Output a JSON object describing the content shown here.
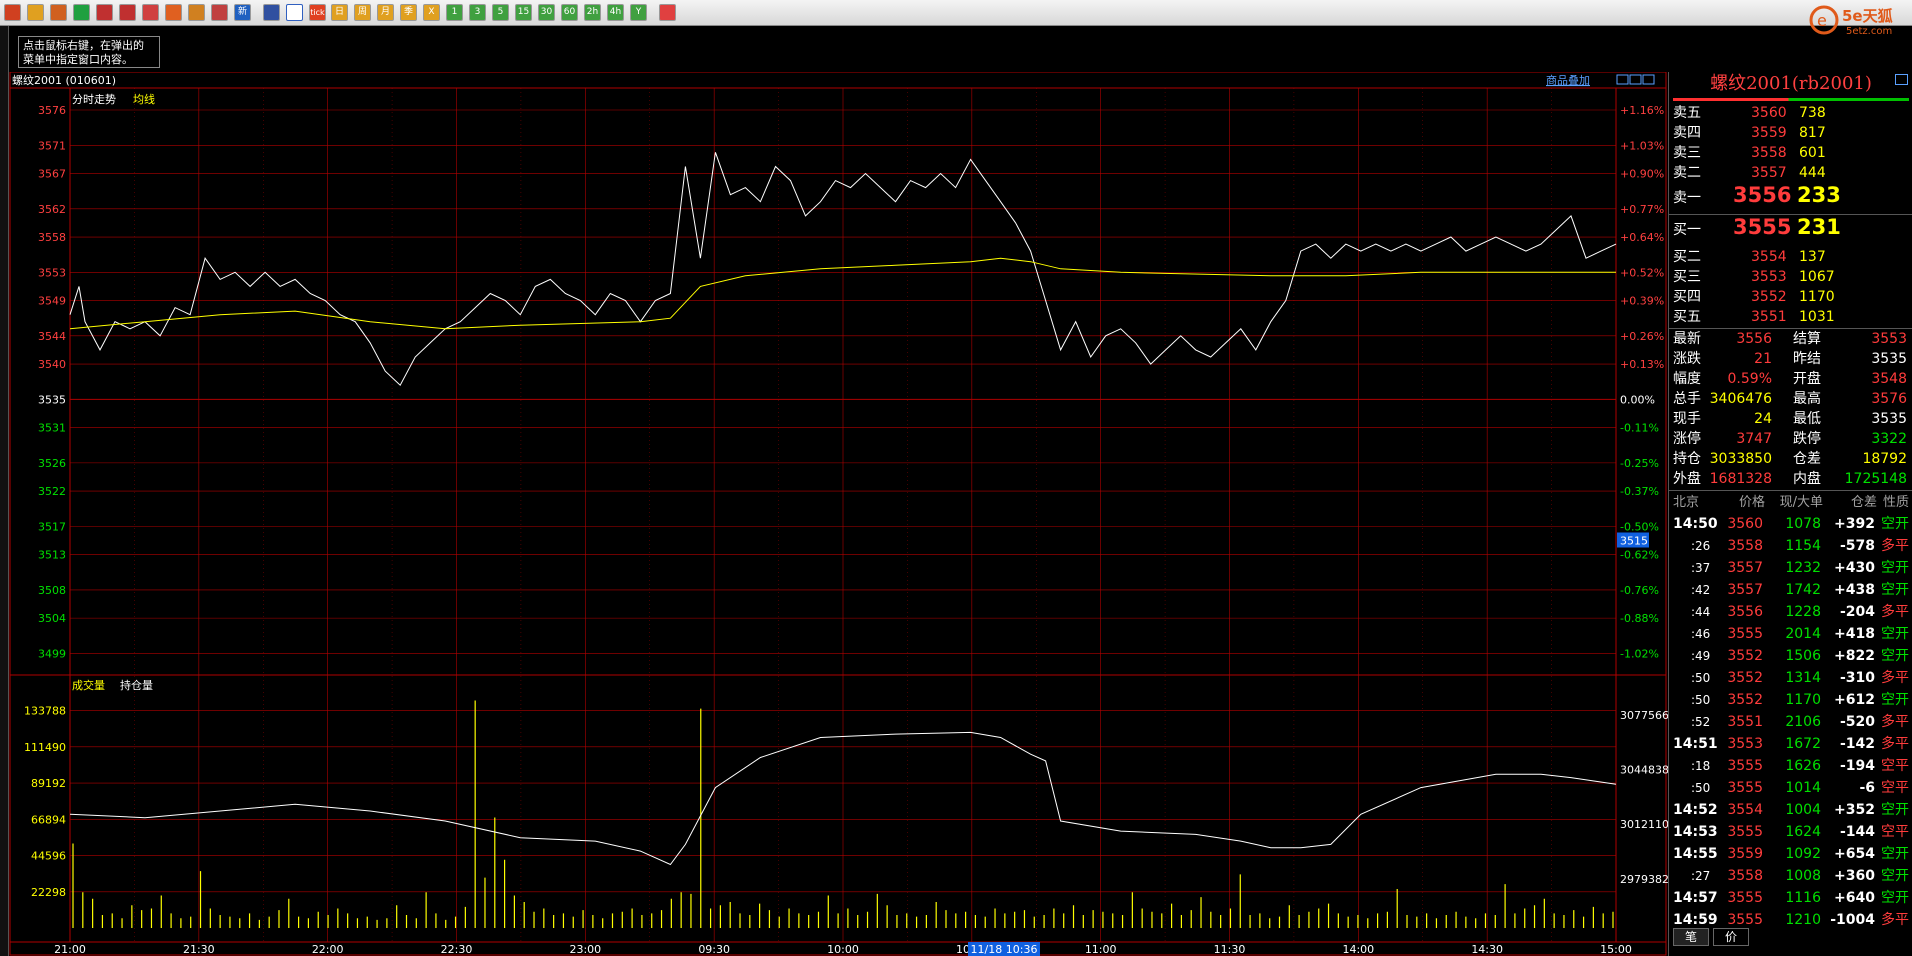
{
  "toolbar": {
    "buttons": [
      "home",
      "doc",
      "tile",
      "refresh",
      "zoom-in",
      "zoom-out",
      "window",
      "pen",
      "hand",
      "filter",
      "new",
      "sep",
      "table",
      "chart",
      "tick",
      "day",
      "week",
      "month",
      "quarter",
      "x",
      "1",
      "3",
      "5",
      "15",
      "30",
      "60",
      "2h",
      "4h",
      "year",
      "sep",
      "calc"
    ],
    "labels": {
      "tick": "tick",
      "day": "日",
      "week": "周",
      "month": "月",
      "quarter": "季",
      "x": "X",
      "1": "1",
      "3": "3",
      "5": "5",
      "15": "15",
      "30": "30",
      "60": "60",
      "2h": "2h",
      "4h": "4h",
      "year": "Y",
      "new": "新"
    }
  },
  "logo": {
    "text": "5e天狐",
    "sub": "5etz.com"
  },
  "hint": {
    "line1": "点击鼠标右键，在弹出的",
    "line2": "菜单中指定窗口内容。"
  },
  "chart_header": {
    "symbol": "螺纹2001 (010601)",
    "overlay_link": "商品叠加"
  },
  "price_panel": {
    "legend_a": "分时走势",
    "legend_b": "均线",
    "cursor_value": "3515"
  },
  "volume_panel": {
    "legend_a": "成交量",
    "legend_b": "持仓量"
  },
  "cursor_time": "11/18 10:36",
  "chart_data": [
    {
      "type": "line",
      "name_series": [
        "分时走势",
        "均线"
      ],
      "x_labels": [
        "21:00",
        "21:30",
        "22:00",
        "22:30",
        "23:00",
        "09:30",
        "10:00",
        "10:30",
        "11:00",
        "11:30",
        "14:00",
        "14:30",
        "15:00"
      ],
      "y_ticks": [
        3576,
        3571,
        3567,
        3562,
        3558,
        3553,
        3549,
        3544,
        3540,
        3535,
        3531,
        3526,
        3522,
        3517,
        3513,
        3508,
        3504,
        3499
      ],
      "y_pct_ticks": [
        "+1.16%",
        "+1.03%",
        "+0.90%",
        "+0.77%",
        "+0.64%",
        "+0.52%",
        "+0.39%",
        "+0.26%",
        "+0.13%",
        "0.00%",
        "-0.11%",
        "-0.25%",
        "-0.37%",
        "-0.50%",
        "-0.62%",
        "-0.76%",
        "-0.88%",
        "-1.02%"
      ],
      "ylim": [
        3497.5,
        3576
      ],
      "base": 3535,
      "price_points": [
        [
          0,
          3547
        ],
        [
          0.6,
          3551
        ],
        [
          1,
          3546
        ],
        [
          2,
          3542
        ],
        [
          3,
          3546
        ],
        [
          4,
          3545
        ],
        [
          5,
          3546
        ],
        [
          6,
          3544
        ],
        [
          7,
          3548
        ],
        [
          8,
          3547
        ],
        [
          9,
          3555
        ],
        [
          10,
          3552
        ],
        [
          11,
          3553
        ],
        [
          12,
          3551
        ],
        [
          13,
          3553
        ],
        [
          14,
          3551
        ],
        [
          15,
          3552
        ],
        [
          16,
          3550
        ],
        [
          17,
          3549
        ],
        [
          18,
          3547
        ],
        [
          19,
          3546
        ],
        [
          20,
          3543
        ],
        [
          21,
          3539
        ],
        [
          22,
          3537
        ],
        [
          23,
          3541
        ],
        [
          24,
          3543
        ],
        [
          25,
          3545
        ],
        [
          26,
          3546
        ],
        [
          27,
          3548
        ],
        [
          28,
          3550
        ],
        [
          29,
          3549
        ],
        [
          30,
          3547
        ],
        [
          31,
          3551
        ],
        [
          32,
          3552
        ],
        [
          33,
          3550
        ],
        [
          34,
          3549
        ],
        [
          35,
          3547
        ],
        [
          36,
          3550
        ],
        [
          37,
          3549
        ],
        [
          38,
          3546
        ],
        [
          39,
          3549
        ],
        [
          40,
          3550
        ],
        [
          41,
          3568
        ],
        [
          42,
          3555
        ],
        [
          43,
          3570
        ],
        [
          44,
          3564
        ],
        [
          45,
          3565
        ],
        [
          46,
          3563
        ],
        [
          47,
          3568
        ],
        [
          48,
          3566
        ],
        [
          49,
          3561
        ],
        [
          50,
          3563
        ],
        [
          51,
          3566
        ],
        [
          52,
          3565
        ],
        [
          53,
          3567
        ],
        [
          54,
          3565
        ],
        [
          55,
          3563
        ],
        [
          56,
          3566
        ],
        [
          57,
          3565
        ],
        [
          58,
          3567
        ],
        [
          59,
          3565
        ],
        [
          60,
          3569
        ],
        [
          61,
          3566
        ],
        [
          62,
          3563
        ],
        [
          63,
          3560
        ],
        [
          64,
          3556
        ],
        [
          65,
          3549
        ],
        [
          66,
          3542
        ],
        [
          67,
          3546
        ],
        [
          68,
          3541
        ],
        [
          69,
          3544
        ],
        [
          70,
          3545
        ],
        [
          71,
          3543
        ],
        [
          72,
          3540
        ],
        [
          73,
          3542
        ],
        [
          74,
          3544
        ],
        [
          75,
          3542
        ],
        [
          76,
          3541
        ],
        [
          77,
          3543
        ],
        [
          78,
          3545
        ],
        [
          79,
          3542
        ],
        [
          80,
          3546
        ],
        [
          81,
          3549
        ],
        [
          82,
          3556
        ],
        [
          83,
          3557
        ],
        [
          84,
          3555
        ],
        [
          85,
          3557
        ],
        [
          86,
          3556
        ],
        [
          87,
          3557
        ],
        [
          88,
          3556
        ],
        [
          89,
          3557
        ],
        [
          90,
          3556
        ],
        [
          91,
          3557
        ],
        [
          92,
          3558
        ],
        [
          93,
          3556
        ],
        [
          94,
          3557
        ],
        [
          95,
          3558
        ],
        [
          96,
          3557
        ],
        [
          97,
          3556
        ],
        [
          98,
          3557
        ],
        [
          99,
          3559
        ],
        [
          100,
          3561
        ],
        [
          101,
          3555
        ],
        [
          102,
          3556
        ],
        [
          103,
          3557
        ]
      ],
      "avg_points": [
        [
          0,
          3545
        ],
        [
          5,
          3546
        ],
        [
          10,
          3547
        ],
        [
          15,
          3547.5
        ],
        [
          20,
          3546
        ],
        [
          25,
          3545
        ],
        [
          30,
          3545.5
        ],
        [
          38,
          3546
        ],
        [
          40,
          3546.5
        ],
        [
          42,
          3551
        ],
        [
          45,
          3552.5
        ],
        [
          50,
          3553.5
        ],
        [
          55,
          3554
        ],
        [
          60,
          3554.5
        ],
        [
          62,
          3555
        ],
        [
          64,
          3554.5
        ],
        [
          66,
          3553.5
        ],
        [
          70,
          3553
        ],
        [
          80,
          3552.5
        ],
        [
          85,
          3552.5
        ],
        [
          90,
          3553
        ],
        [
          100,
          3553
        ],
        [
          103,
          3553
        ]
      ]
    },
    {
      "type": "bar",
      "name_series": [
        "成交量",
        "持仓量"
      ],
      "y_ticks": [
        133788,
        111490,
        89192,
        66894,
        44596,
        22298
      ],
      "y_right_ticks": [
        3077566,
        3044838,
        3012110,
        2979382
      ],
      "ylim": [
        0,
        144000
      ],
      "oi_lim": [
        2950000,
        3090000
      ],
      "volume_values": [
        52000,
        22000,
        18000,
        8000,
        9000,
        6000,
        14000,
        11000,
        12000,
        20000,
        9000,
        6000,
        7000,
        35000,
        12000,
        8000,
        7000,
        6000,
        9000,
        5000,
        7000,
        11000,
        18000,
        7000,
        6000,
        10000,
        8000,
        12000,
        9000,
        6000,
        7000,
        5000,
        6000,
        14000,
        8000,
        6000,
        22000,
        9000,
        5000,
        7000,
        13000,
        140000,
        31000,
        68000,
        42000,
        20000,
        16000,
        10000,
        12000,
        8000,
        9000,
        7000,
        11000,
        8000,
        6000,
        9000,
        10000,
        12000,
        8000,
        9000,
        11000,
        18000,
        22000,
        21000,
        135000,
        12000,
        14000,
        16000,
        9000,
        8000,
        15000,
        11000,
        7000,
        12000,
        9000,
        8000,
        10000,
        20000,
        9000,
        12000,
        8000,
        10000,
        21000,
        14000,
        8000,
        9000,
        7000,
        8000,
        16000,
        11000,
        9000,
        10000,
        8000,
        7000,
        12000,
        9000,
        10000,
        11000,
        7000,
        8000,
        12000,
        9000,
        14000,
        8000,
        11000,
        10000,
        9000,
        8000,
        22000,
        12000,
        10000,
        9000,
        15000,
        8000,
        11000,
        19000,
        10000,
        8000,
        12000,
        33000,
        8000,
        9000,
        6000,
        7000,
        14000,
        8000,
        10000,
        12000,
        15000,
        9000,
        7000,
        8000,
        6000,
        9000,
        10000,
        24000,
        8000,
        7000,
        9000,
        6000,
        8000,
        10000,
        7000,
        6000,
        9000,
        8000,
        27000,
        9000,
        12000,
        14000,
        18000,
        9000,
        8000,
        11000,
        7000,
        13000,
        9000,
        10000
      ],
      "oi_points": [
        [
          0,
          3018000
        ],
        [
          5,
          3016000
        ],
        [
          10,
          3020000
        ],
        [
          15,
          3024000
        ],
        [
          20,
          3020000
        ],
        [
          25,
          3014000
        ],
        [
          30,
          3004000
        ],
        [
          35,
          3002000
        ],
        [
          38,
          2996000
        ],
        [
          40,
          2988000
        ],
        [
          41,
          3000000
        ],
        [
          43,
          3034000
        ],
        [
          46,
          3052000
        ],
        [
          50,
          3064000
        ],
        [
          55,
          3066000
        ],
        [
          60,
          3067000
        ],
        [
          62,
          3064000
        ],
        [
          64,
          3054000
        ],
        [
          65,
          3050000
        ],
        [
          66,
          3014000
        ],
        [
          70,
          3008000
        ],
        [
          75,
          3006000
        ],
        [
          78,
          3002000
        ],
        [
          80,
          2998000
        ],
        [
          82,
          2998000
        ],
        [
          84,
          3000000
        ],
        [
          86,
          3018000
        ],
        [
          90,
          3034000
        ],
        [
          95,
          3042000
        ],
        [
          98,
          3042000
        ],
        [
          100,
          3040000
        ],
        [
          103,
          3036000
        ]
      ]
    }
  ],
  "quote": {
    "title": "螺纹2001(rb2001)",
    "asks": [
      {
        "label": "卖五",
        "price": "3560",
        "vol": "738"
      },
      {
        "label": "卖四",
        "price": "3559",
        "vol": "817"
      },
      {
        "label": "卖三",
        "price": "3558",
        "vol": "601"
      },
      {
        "label": "卖二",
        "price": "3557",
        "vol": "444"
      },
      {
        "label": "卖一",
        "price": "3556",
        "vol": "233"
      }
    ],
    "bids": [
      {
        "label": "买一",
        "price": "3555",
        "vol": "231"
      },
      {
        "label": "买二",
        "price": "3554",
        "vol": "137"
      },
      {
        "label": "买三",
        "price": "3553",
        "vol": "1067"
      },
      {
        "label": "买四",
        "price": "3552",
        "vol": "1170"
      },
      {
        "label": "买五",
        "price": "3551",
        "vol": "1031"
      }
    ],
    "stats": [
      {
        "l1": "最新",
        "v1": "3556",
        "c1": "red",
        "l2": "结算",
        "v2": "3553",
        "c2": "red"
      },
      {
        "l1": "涨跌",
        "v1": "21",
        "c1": "red",
        "l2": "昨结",
        "v2": "3535",
        "c2": "white"
      },
      {
        "l1": "幅度",
        "v1": "0.59%",
        "c1": "red",
        "l2": "开盘",
        "v2": "3548",
        "c2": "red"
      },
      {
        "l1": "总手",
        "v1": "3406476",
        "c1": "yellow",
        "l2": "最高",
        "v2": "3576",
        "c2": "red"
      },
      {
        "l1": "现手",
        "v1": "24",
        "c1": "yellow",
        "l2": "最低",
        "v2": "3535",
        "c2": "white"
      },
      {
        "l1": "涨停",
        "v1": "3747",
        "c1": "red",
        "l2": "跌停",
        "v2": "3322",
        "c2": "green"
      },
      {
        "l1": "持仓",
        "v1": "3033850",
        "c1": "yellow",
        "l2": "仓差",
        "v2": "18792",
        "c2": "yellow"
      },
      {
        "l1": "外盘",
        "v1": "1681328",
        "c1": "red",
        "l2": "内盘",
        "v2": "1725148",
        "c2": "green"
      }
    ],
    "ticks_header": {
      "time": "北京",
      "price": "价格",
      "vol": "现/大单",
      "diff": "仓差",
      "nature": "性质"
    },
    "ticks": [
      {
        "t": "14:50",
        "bold": true,
        "p": "3560",
        "v": "1078",
        "d": "+392",
        "n": "空开",
        "nc": "green"
      },
      {
        "t": ":26",
        "bold": false,
        "p": "3558",
        "v": "1154",
        "d": "-578",
        "n": "多平",
        "nc": "red"
      },
      {
        "t": ":37",
        "bold": false,
        "p": "3557",
        "v": "1232",
        "d": "+430",
        "n": "空开",
        "nc": "green"
      },
      {
        "t": ":42",
        "bold": false,
        "p": "3557",
        "v": "1742",
        "d": "+438",
        "n": "空开",
        "nc": "green"
      },
      {
        "t": ":44",
        "bold": false,
        "p": "3556",
        "v": "1228",
        "d": "-204",
        "n": "多平",
        "nc": "red"
      },
      {
        "t": ":46",
        "bold": false,
        "p": "3555",
        "v": "2014",
        "d": "+418",
        "n": "空开",
        "nc": "green"
      },
      {
        "t": ":49",
        "bold": false,
        "p": "3552",
        "v": "1506",
        "d": "+822",
        "n": "空开",
        "nc": "green"
      },
      {
        "t": ":50",
        "bold": false,
        "p": "3552",
        "v": "1314",
        "d": "-310",
        "n": "多平",
        "nc": "red"
      },
      {
        "t": ":50",
        "bold": false,
        "p": "3552",
        "v": "1170",
        "d": "+612",
        "n": "空开",
        "nc": "green"
      },
      {
        "t": ":52",
        "bold": false,
        "p": "3551",
        "v": "2106",
        "d": "-520",
        "n": "多平",
        "nc": "red"
      },
      {
        "t": "14:51",
        "bold": true,
        "p": "3553",
        "v": "1672",
        "d": "-142",
        "n": "多平",
        "nc": "red"
      },
      {
        "t": ":18",
        "bold": false,
        "p": "3555",
        "v": "1626",
        "d": "-194",
        "n": "空平",
        "nc": "red"
      },
      {
        "t": ":50",
        "bold": false,
        "p": "3555",
        "v": "1014",
        "d": "-6",
        "n": "空平",
        "nc": "red"
      },
      {
        "t": "14:52",
        "bold": true,
        "p": "3554",
        "v": "1004",
        "d": "+352",
        "n": "空开",
        "nc": "green"
      },
      {
        "t": "14:53",
        "bold": true,
        "p": "3555",
        "v": "1624",
        "d": "-144",
        "n": "空平",
        "nc": "red"
      },
      {
        "t": "14:55",
        "bold": true,
        "p": "3559",
        "v": "1092",
        "d": "+654",
        "n": "空开",
        "nc": "green"
      },
      {
        "t": ":27",
        "bold": false,
        "p": "3558",
        "v": "1008",
        "d": "+360",
        "n": "空开",
        "nc": "green"
      },
      {
        "t": "14:57",
        "bold": true,
        "p": "3555",
        "v": "1116",
        "d": "+640",
        "n": "空开",
        "nc": "green"
      },
      {
        "t": "14:59",
        "bold": true,
        "p": "3555",
        "v": "1210",
        "d": "-1004",
        "n": "多平",
        "nc": "red"
      }
    ],
    "bottom_tabs": [
      "笔",
      "价"
    ]
  }
}
